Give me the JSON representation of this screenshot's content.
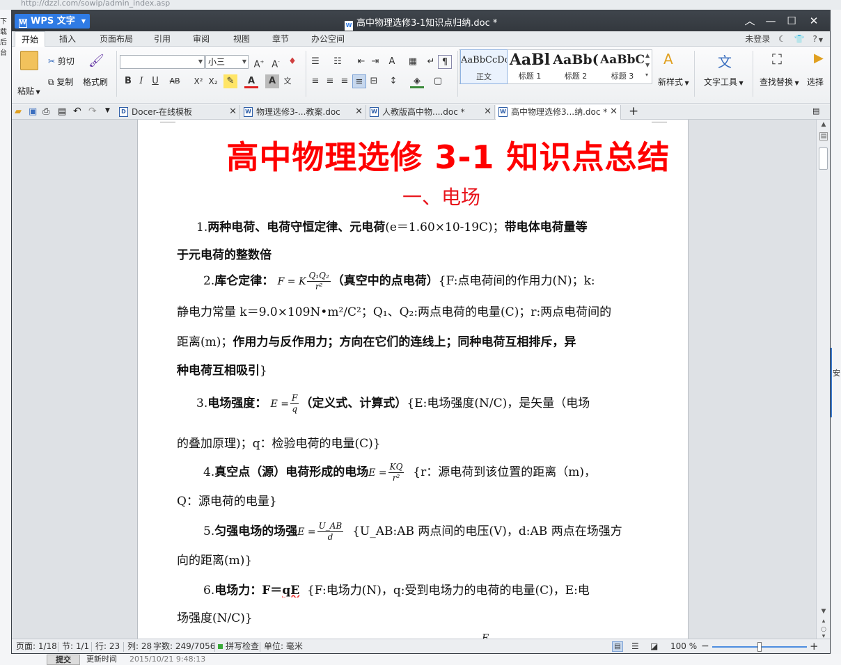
{
  "background": {
    "url_text": "http://dzzl.com/sowip/admin_index.asp",
    "left_fragment_1": "下载",
    "left_fragment_2": "后台",
    "right_fragment": "安",
    "submit_label": "提交",
    "updated_label": "更新时间",
    "updated_value": "2015/10/21 9:48:13"
  },
  "titlebar": {
    "app_name": "WPS 文字",
    "document_title": "高中物理选修3-1知识点归纳.doc *"
  },
  "menubar": {
    "tabs": [
      "开始",
      "插入",
      "页面布局",
      "引用",
      "审阅",
      "视图",
      "章节",
      "办公空间"
    ],
    "active_tab": "开始",
    "login_status": "未登录",
    "help_label": "?"
  },
  "ribbon": {
    "paste_label": "粘贴",
    "cut_label": "剪切",
    "copy_label": "复制",
    "format_painter_label": "格式刷",
    "font_name": "",
    "font_size": "小三",
    "styles": [
      {
        "preview": "AaBbCcDc",
        "name": "正文"
      },
      {
        "preview": "AaBl",
        "name": "标题 1"
      },
      {
        "preview": "AaBb(",
        "name": "标题 2"
      },
      {
        "preview": "AaBbC",
        "name": "标题 3"
      }
    ],
    "new_style_label": "新样式",
    "text_tools_label": "文字工具",
    "find_replace_label": "查找替换",
    "select_label": "选择"
  },
  "tabs": [
    {
      "label": "Docer-在线模板",
      "icon": "D"
    },
    {
      "label": "物理选修3-...教案.doc",
      "icon": "W"
    },
    {
      "label": "人教版高中物....doc *",
      "icon": "W"
    },
    {
      "label": "高中物理选修3...纳.doc *",
      "icon": "W"
    }
  ],
  "document": {
    "heading": "高中物理选修 3-1 知识点总结",
    "section": "一、电场",
    "p1_prefix": "1.",
    "p1_bold": "两种电荷、电荷守恒定律、元电荷",
    "p1_plain": "(e＝1.60×10-19C)；",
    "p1_bold2": "带电体电荷量等",
    "p1_line2": "于元电荷的整数倍",
    "p2_prefix": "2.",
    "p2_bold": "库仑定律：",
    "p2_formula_lhs": "F = K",
    "p2_formula_num": "Q₁Q₂",
    "p2_formula_den": "r²",
    "p2_bold2": "（真空中的点电荷）",
    "p2_plain": "{F:点电荷间的作用力(N)；k:",
    "p2_line2": "静电力常量 k＝9.0×109N•m²/C²；Q₁、Q₂:两点电荷的电量(C)；r:两点电荷间的",
    "p2_line3_plain": "距离(m)；",
    "p2_line3_bold": "作用力与反作用力；方向在它们的连线上；同种电荷互相排斥，异",
    "p2_line4_bold": "种电荷互相吸引",
    "p2_line4_plain": "}",
    "p3_prefix": "3.",
    "p3_bold": "电场强度：",
    "p3_formula_lhs": "E =",
    "p3_formula_num": "F",
    "p3_formula_den": "q",
    "p3_bold2": "（定义式、计算式）",
    "p3_plain": "{E:电场强度(N/C)，是矢量（电场",
    "p3_line2": "的叠加原理)；q：检验电荷的电量(C)}",
    "p4_prefix": "4.",
    "p4_bold": "真空点（源）电荷形成的电场",
    "p4_formula_lhs": "E =",
    "p4_formula_num": "KQ",
    "p4_formula_den": "r²",
    "p4_plain": "{r：源电荷到该位置的距离（m)，",
    "p4_line2": "Q：源电荷的电量}",
    "p5_prefix": "5.",
    "p5_bold": "匀强电场的场强",
    "p5_formula_lhs": "E =",
    "p5_formula_num": "U_AB",
    "p5_formula_den": "d",
    "p5_plain": "{U_AB:AB 两点间的电压(V)，d:AB 两点在场强方",
    "p5_line2": "向的距离(m)}",
    "p6_prefix": "6.",
    "p6_bold": "电场力：F＝",
    "p6_bold_wavy": "qE",
    "p6_plain": "{F:电场力(N)，q:受到电场力的电荷的电量(C)，E:电",
    "p6_line2": "场强度(N/C)}",
    "partial_next": "F"
  },
  "statusbar": {
    "page": "页面: 1/18",
    "section": "节: 1/1",
    "row": "行: 23",
    "column": "列: 28",
    "word_count": "字数: 249/7056",
    "spellcheck": "拼写检查",
    "unit": "单位: 毫米",
    "zoom": "100 %",
    "zoom_level": 0.5
  }
}
